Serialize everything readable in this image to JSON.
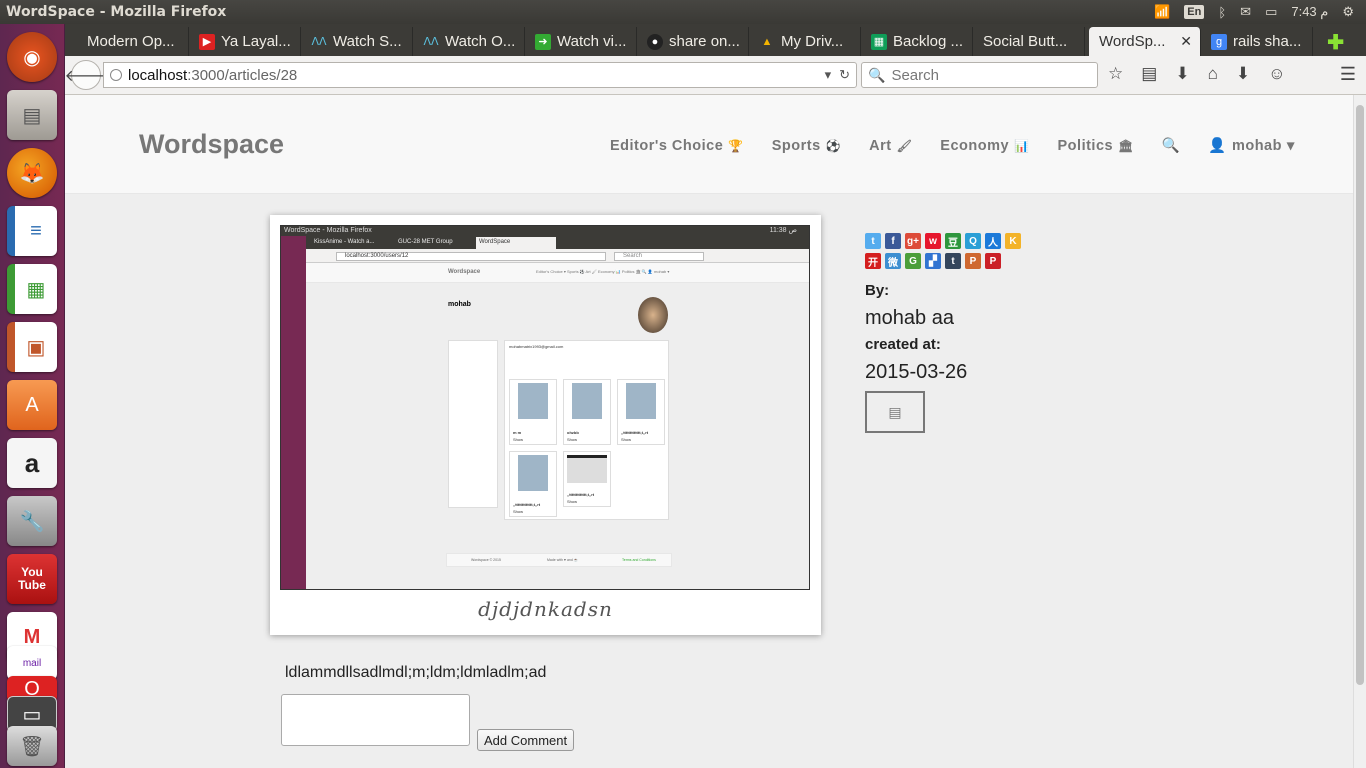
{
  "window": {
    "title": "WordSpace - Mozilla Firefox"
  },
  "tray": {
    "lang": "En",
    "clock": "7:43 م"
  },
  "launcher": {
    "items": [
      "ubuntu-dash-icon",
      "files-icon",
      "firefox-icon",
      "writer-icon",
      "calc-icon",
      "impress-icon",
      "software-center-icon",
      "amazon-icon",
      "settings-icon",
      "youtube-icon",
      "gmail-icon",
      "yahoo-mail-icon",
      "opera-icon",
      "workspace-icon",
      "trash-icon"
    ],
    "youtube_label": "You Tube",
    "mail_label": "mail"
  },
  "tabs": [
    {
      "label": "Modern Op...",
      "icon": ""
    },
    {
      "label": "Ya Layal...",
      "icon": "youtube"
    },
    {
      "label": "Watch S...",
      "icon": "watch"
    },
    {
      "label": "Watch O...",
      "icon": "watch"
    },
    {
      "label": "Watch vi...",
      "icon": "play"
    },
    {
      "label": "share on...",
      "icon": "github"
    },
    {
      "label": "My Driv...",
      "icon": "drive"
    },
    {
      "label": "Backlog ...",
      "icon": "sheets"
    },
    {
      "label": "Social Butt...",
      "icon": ""
    },
    {
      "label": "WordSp...",
      "icon": "",
      "active": true
    },
    {
      "label": "rails sha...",
      "icon": "google"
    }
  ],
  "nav": {
    "url_host": "localhost",
    "url_path": ":3000/articles/28",
    "search_placeholder": "Search"
  },
  "site": {
    "brand": "Wordspace",
    "menu": [
      {
        "label": "Editor's Choice",
        "icon": "🏆"
      },
      {
        "label": "Sports",
        "icon": "⚽"
      },
      {
        "label": "Art",
        "icon": "🖌"
      },
      {
        "label": "Economy",
        "icon": "📊"
      },
      {
        "label": "Politics",
        "icon": "🏛"
      }
    ],
    "search_icon": "🔍",
    "user": "mohab"
  },
  "article": {
    "image_caption": "djdjdnkadsn",
    "body": "ldlammdllsadlmdl;m;ldm;ldmladlm;ad",
    "by_label": "By:",
    "author": "mohab aa",
    "created_label": "created at:",
    "created_at": "2015-03-26",
    "comment_button": "Add Comment"
  },
  "inner_screenshot": {
    "title": "WordSpace - Mozilla Firefox",
    "clock": "11:38 ص",
    "tabs": [
      "KissAnime - Watch a...",
      "GUC-28 MET Group",
      "WordSpace"
    ],
    "url": "localhost:3000/users/12",
    "search": "Search",
    "brand": "Wordspace",
    "menu": "Editor's Choice ▾   Sports ⚽   Art 🖌   Economy 📊   Politics 🏛   🔍   👤 mohab ▾",
    "profile_name": "mohab",
    "email": "mohabmatrix1993@gmail.com",
    "cards": [
      "m m",
      "ohzbb",
      ",,ttttttttttttt,t,,rt",
      ",,ttttttttttttt,t,,rt",
      ",,ttttttttttttt,t,,rt"
    ],
    "card_show": "Show",
    "footer_left": "Wordspace © 2015",
    "footer_mid": "Made with ♥ and ☕",
    "footer_right": "Terms and Conditions"
  },
  "colors": {
    "launcher": "#772953",
    "panel": "#3c3b37",
    "header_bg": "#f8f8f8",
    "page_bg": "#eeeeee",
    "brand": "#777777"
  }
}
